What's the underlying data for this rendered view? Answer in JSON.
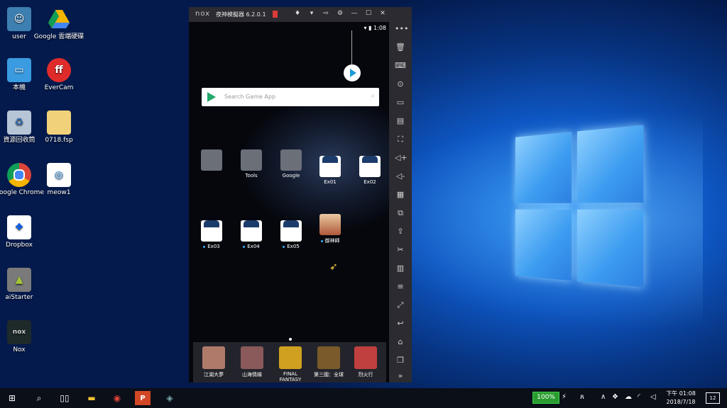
{
  "desktop": {
    "icons": [
      {
        "label": "user",
        "color": "#3c7fb0"
      },
      {
        "label": "Google 雲端硬碟",
        "color": "#f4b400"
      },
      {
        "label": "本機",
        "color": "#3a9be0"
      },
      {
        "label": "EverCam",
        "color": "#e02b2b"
      },
      {
        "label": "資源回收筒",
        "color": "#b7c6d6"
      },
      {
        "label": "0718.fsp",
        "color": "#f1d27a"
      },
      {
        "label": "Google Chrome",
        "color": "#db4437"
      },
      {
        "label": "meow1",
        "color": "#ffffff"
      },
      {
        "label": "Dropbox",
        "color": "#0061fe"
      },
      {
        "label": "aiStarter",
        "color": "#7a7a7a"
      },
      {
        "label": "Nox",
        "color": "#1e2a2a"
      }
    ]
  },
  "nox": {
    "title": "夜神模擬器 6.2.0.1",
    "logo": "nox",
    "status_time": "1:08",
    "search_placeholder": "Search Game App",
    "apps": [
      {
        "label": ""
      },
      {
        "label": "Tools"
      },
      {
        "label": "Google"
      },
      {
        "label": "Ex01"
      },
      {
        "label": "Ex02"
      },
      {
        "label": "Ex03"
      },
      {
        "label": "Ex04"
      },
      {
        "label": "Ex05"
      },
      {
        "label": "御神師"
      }
    ],
    "dock": [
      {
        "label": "江湖大夢",
        "color": "#b07a6a"
      },
      {
        "label": "山海情緣",
        "color": "#8a5a5a"
      },
      {
        "label": "FINAL FANTASY",
        "color": "#d0a020"
      },
      {
        "label": "第三國：全球",
        "color": "#7a5a2a"
      },
      {
        "label": "烈火行",
        "color": "#c04040"
      }
    ],
    "sidebar_icons": [
      "more-icon",
      "trash-icon",
      "keyboard-icon",
      "location-icon",
      "screen-icon",
      "apk-icon",
      "fullscreen-icon",
      "volume-up-icon",
      "volume-down-icon",
      "toolbox-icon",
      "multi-window-icon",
      "install-icon",
      "scissors-icon",
      "chart-icon",
      "menu-icon",
      "resize-icon",
      "back-icon",
      "home-icon",
      "recent-icon",
      "expand-icon"
    ]
  },
  "taskbar": {
    "battery": "100%",
    "clock_line1": "下午 01:08",
    "clock_line2": "2018/7/18",
    "notifications": "12"
  }
}
